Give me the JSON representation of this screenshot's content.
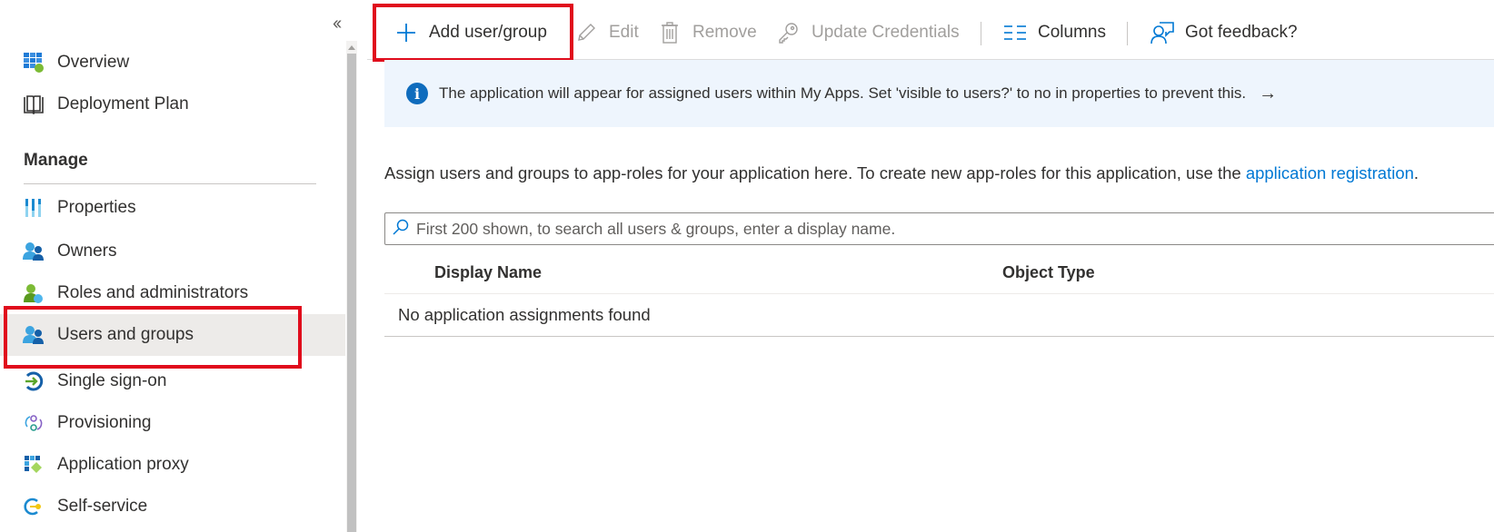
{
  "sidebar": {
    "collapse_label": "«",
    "items_top": [
      {
        "label": "Overview",
        "icon": "overview-grid-icon"
      },
      {
        "label": "Deployment Plan",
        "icon": "book-icon"
      }
    ],
    "section_header": "Manage",
    "items_manage": [
      {
        "label": "Properties",
        "icon": "properties-icon"
      },
      {
        "label": "Owners",
        "icon": "users-icon"
      },
      {
        "label": "Roles and administrators",
        "icon": "roles-icon"
      },
      {
        "label": "Users and groups",
        "icon": "users-icon",
        "selected": true
      },
      {
        "label": "Single sign-on",
        "icon": "sign-on-arrow-icon"
      },
      {
        "label": "Provisioning",
        "icon": "provisioning-icon"
      },
      {
        "label": "Application proxy",
        "icon": "app-proxy-icon"
      },
      {
        "label": "Self-service",
        "icon": "key-icon"
      }
    ]
  },
  "toolbar": {
    "add_label": "Add user/group",
    "edit_label": "Edit",
    "remove_label": "Remove",
    "update_credentials_label": "Update Credentials",
    "columns_label": "Columns",
    "feedback_label": "Got feedback?"
  },
  "banner": {
    "text": "The application will appear for assigned users within My Apps. Set 'visible to users?' to no in properties to prevent this.",
    "arrow": "→"
  },
  "description": {
    "text": "Assign users and groups to app-roles for your application here. To create new app-roles for this application, use the ",
    "link": "application registration",
    "suffix": "."
  },
  "search": {
    "placeholder": "First 200 shown, to search all users & groups, enter a display name.",
    "value": ""
  },
  "table": {
    "columns": [
      "Display Name",
      "Object Type"
    ],
    "empty_message": "No application assignments found"
  },
  "colors": {
    "accent": "#0078d4",
    "highlight": "#e00b1c",
    "banner_bg": "#eef5fd",
    "selected_bg": "#edebe9"
  }
}
